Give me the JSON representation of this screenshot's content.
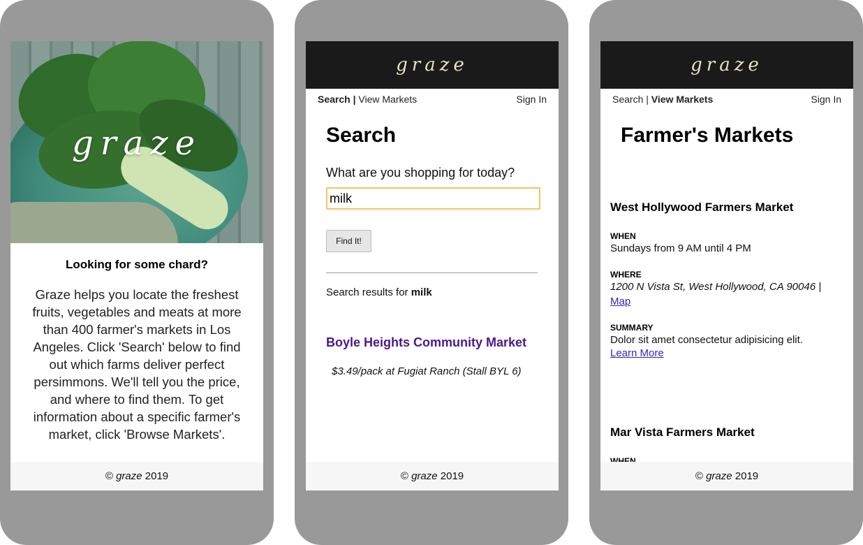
{
  "footer": {
    "copyright_symbol": "©",
    "brand": "graze",
    "year": "2019"
  },
  "brand_logo": "graze",
  "screen1": {
    "heading": "Looking for some chard?",
    "body": "Graze helps you locate the freshest fruits, vegetables and meats at more than 400 farmer's markets in Los Angeles. Click 'Search' below to find out which farms deliver perfect persimmons. We'll tell you the price, and where to find them. To get information about a specific farmer's market, click 'Browse Markets'."
  },
  "nav": {
    "search": "Search",
    "separator": "|",
    "view_markets": "View Markets",
    "sign_in": "Sign In"
  },
  "screen2": {
    "title": "Search",
    "prompt": "What are you shopping for today?",
    "search_value": "milk",
    "button_label": "Find It!",
    "results_prefix": "Search results for",
    "results_term": "milk",
    "result_market": "Boyle Heights Community Market",
    "result_detail": "$3.49/pack at Fugiat Ranch (Stall BYL 6)"
  },
  "screen3": {
    "title": "Farmer's Markets",
    "markets": [
      {
        "name": "West Hollywood Farmers Market",
        "when_label": "WHEN",
        "when": "Sundays from 9 AM until 4 PM",
        "where_label": "WHERE",
        "where": "1200 N Vista St, West Hollywood, CA 90046 |",
        "map_link": "Map",
        "summary_label": "SUMMARY",
        "summary": "Dolor sit amet consectetur adipisicing elit.",
        "learn_more": "Learn More"
      },
      {
        "name": "Mar Vista Farmers Market",
        "when_label": "WHEN"
      }
    ]
  },
  "colors": {
    "phone_frame": "#999999",
    "header_bar": "#1a1a1a",
    "market_link": "#4a1a87",
    "input_focus": "#f0c46a"
  }
}
